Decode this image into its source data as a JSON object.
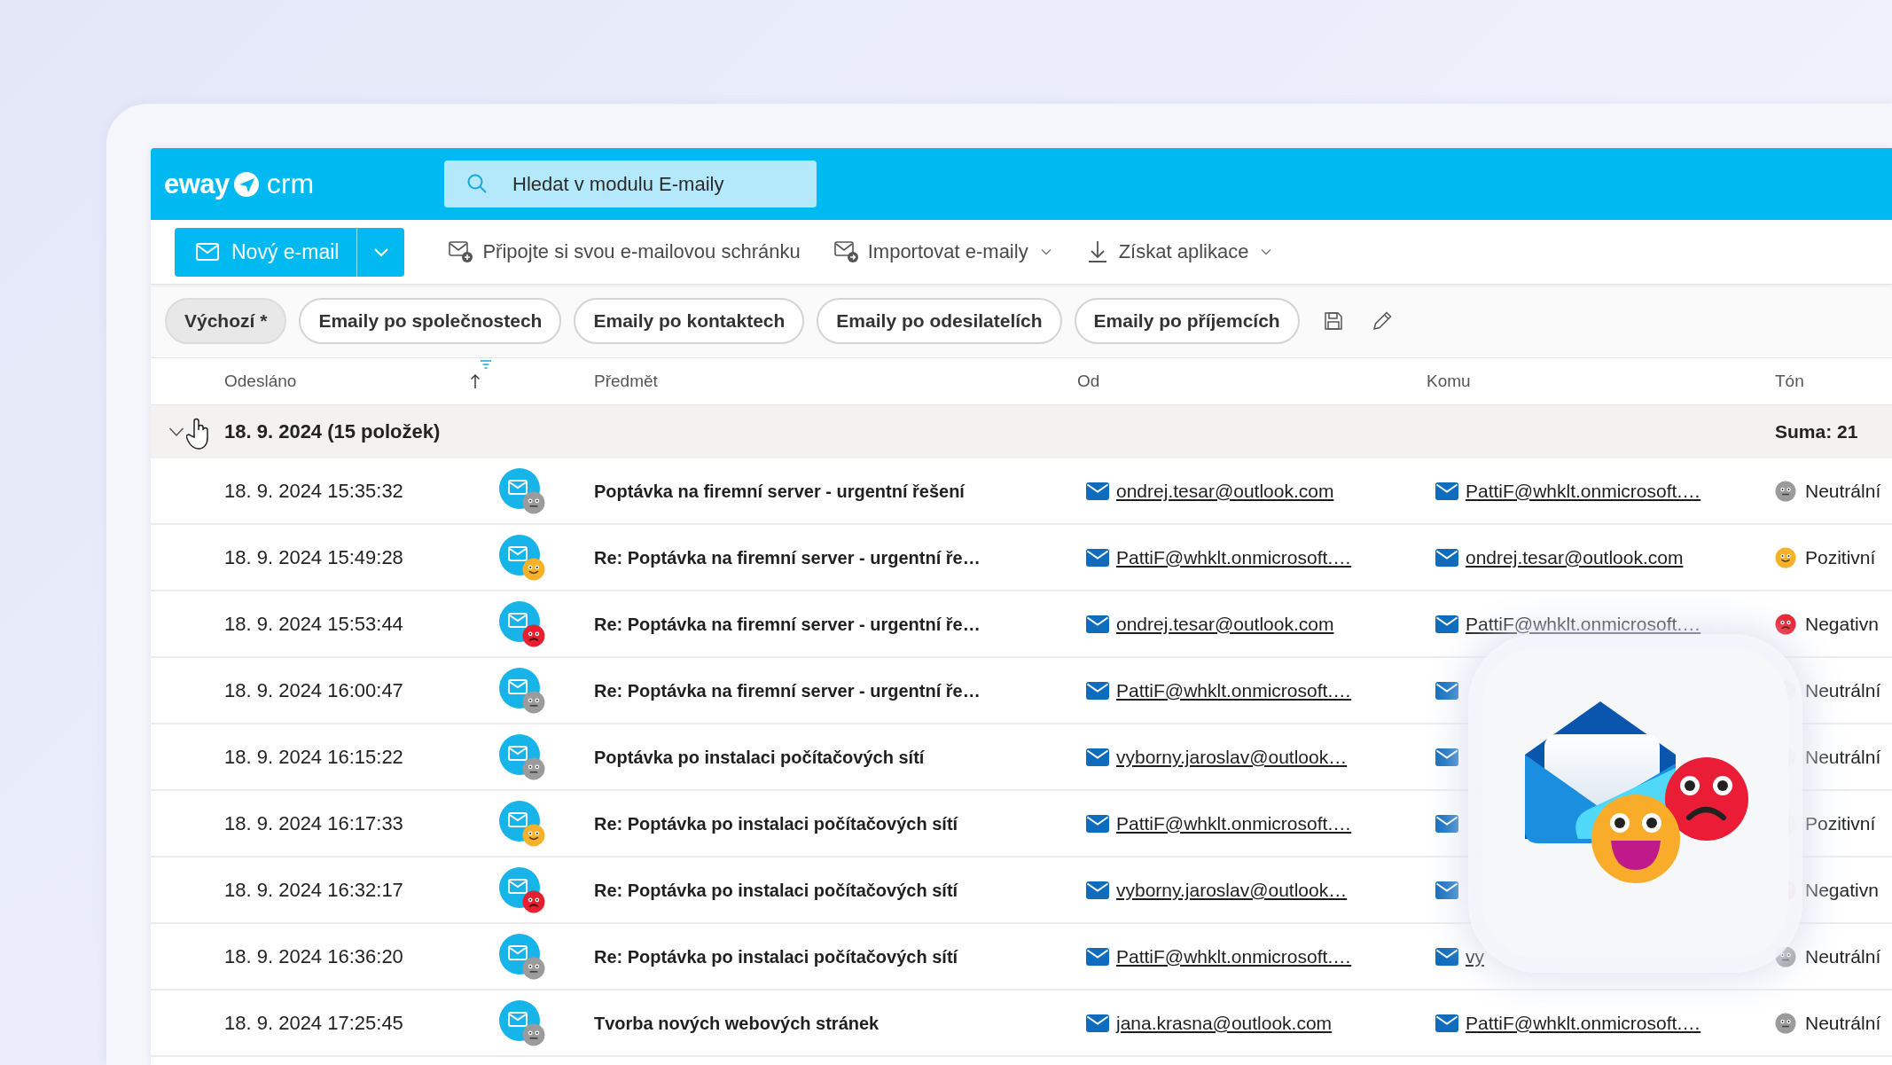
{
  "header": {
    "logo": {
      "brand": "eway",
      "product": "crm"
    },
    "search": {
      "placeholder": "Hledat v modulu E-maily"
    }
  },
  "toolbar": {
    "new_button": "Nový e-mail",
    "actions": [
      {
        "kind": "connect",
        "label": "Připojte si svou e-mailovou schránku",
        "dropdown": false
      },
      {
        "kind": "import",
        "label": "Importovat e-maily",
        "dropdown": true
      },
      {
        "kind": "download",
        "label": "Získat aplikace",
        "dropdown": true
      }
    ]
  },
  "views": [
    {
      "label": "Výchozí *",
      "selected": true
    },
    {
      "label": "Emaily po společnostech",
      "selected": false
    },
    {
      "label": "Emaily po kontaktech",
      "selected": false
    },
    {
      "label": "Emaily po odesilatelích",
      "selected": false
    },
    {
      "label": "Emaily po příjemcích",
      "selected": false
    }
  ],
  "table": {
    "columns": [
      "Odesláno",
      "Předmět",
      "Od",
      "Komu",
      "Tón"
    ],
    "group": {
      "label": "18. 9. 2024 (15 položek)",
      "sum": "Suma: 21",
      "expanded": true
    },
    "rows": [
      {
        "sent": "18. 9. 2024 15:35:32",
        "subject": "Poptávka na firemní server - urgentní řešení",
        "from": "ondrej.tesar@outlook.com",
        "to": "PattiF@whklt.onmicrosoft.…",
        "tone": {
          "kind": "neutral",
          "label": "Neutrální"
        }
      },
      {
        "sent": "18. 9. 2024 15:49:28",
        "subject": "Re: Poptávka na firemní server - urgentní ře…",
        "from": "PattiF@whklt.onmicrosoft.…",
        "to": "ondrej.tesar@outlook.com",
        "tone": {
          "kind": "positive",
          "label": "Pozitivní"
        }
      },
      {
        "sent": "18. 9. 2024 15:53:44",
        "subject": "Re: Poptávka na firemní server - urgentní ře…",
        "from": "ondrej.tesar@outlook.com",
        "to": "PattiF@whklt.onmicrosoft.…",
        "tone": {
          "kind": "negative",
          "label": "Negativn"
        }
      },
      {
        "sent": "18. 9. 2024 16:00:47",
        "subject": "Re: Poptávka na firemní server - urgentní ře…",
        "from": "PattiF@whklt.onmicrosoft.…",
        "tone": {
          "kind": "neutral",
          "label": "Neutrální"
        }
      },
      {
        "sent": "18. 9. 2024 16:15:22",
        "subject": "Poptávka po instalaci počítačových sítí",
        "from": "vyborny.jaroslav@outlook…",
        "tone": {
          "kind": "neutral",
          "label": "Neutrální"
        }
      },
      {
        "sent": "18. 9. 2024 16:17:33",
        "subject": "Re: Poptávka po instalaci počítačových sítí",
        "from": "PattiF@whklt.onmicrosoft.…",
        "tone": {
          "kind": "positive",
          "label": "Pozitivní"
        }
      },
      {
        "sent": "18. 9. 2024 16:32:17",
        "subject": "Re: Poptávka po instalaci počítačových sítí",
        "from": "vyborny.jaroslav@outlook…",
        "tone": {
          "kind": "negative",
          "label": "Negativn"
        }
      },
      {
        "sent": "18. 9. 2024 16:36:20",
        "subject": "Re: Poptávka po instalaci počítačových sítí",
        "from": "PattiF@whklt.onmicrosoft.…",
        "to": "vy",
        "tone": {
          "kind": "neutral",
          "label": "Neutrální"
        }
      },
      {
        "sent": "18. 9. 2024 17:25:45",
        "subject": "Tvorba nových webových stránek",
        "from": "jana.krasna@outlook.com",
        "to": "PattiF@whklt.onmicrosoft.…",
        "tone": {
          "kind": "neutral",
          "label": "Neutrální"
        }
      }
    ]
  }
}
